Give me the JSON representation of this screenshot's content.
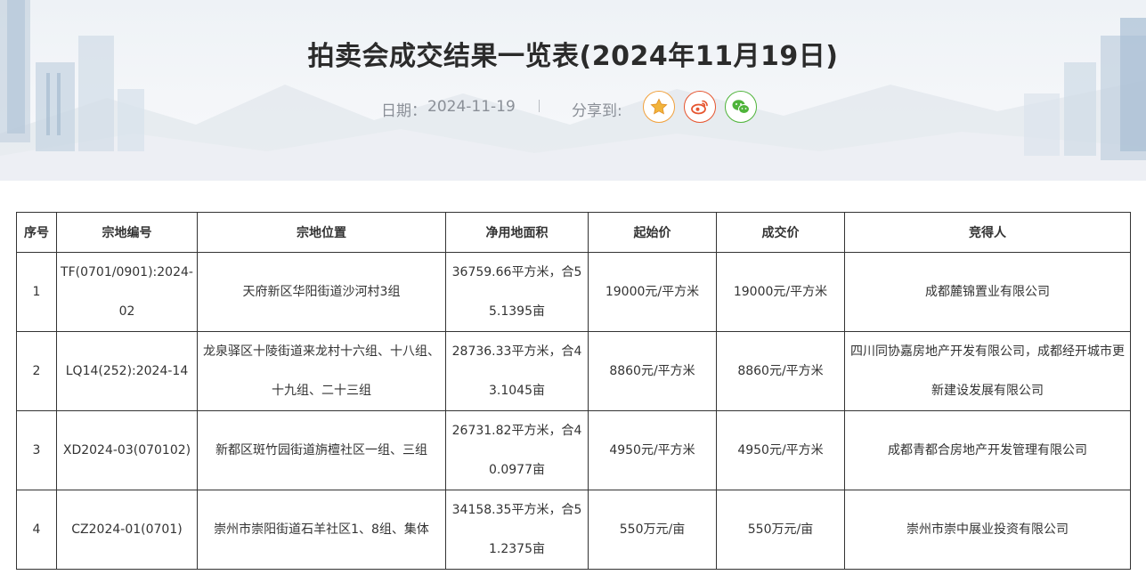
{
  "header": {
    "title": "拍卖会成交结果一览表(2024年11月19日)",
    "date_label": "日期：",
    "date": "2024-11-19",
    "separator": "|",
    "share_label": "分享到:"
  },
  "share_icons": [
    "star-icon",
    "weibo-icon",
    "wechat-icon"
  ],
  "colors": {
    "star": "#f1a13c",
    "weibo": "#e6552f",
    "wechat": "#4fb43a"
  },
  "table": {
    "headers": [
      "序号",
      "宗地编号",
      "宗地位置",
      "净用地面积",
      "起始价",
      "成交价",
      "竞得人"
    ],
    "rows": [
      [
        "1",
        "TF(0701/0901):2024-02",
        "天府新区华阳街道沙河村3组",
        "36759.66平方米，合55.1395亩",
        "19000元/平方米",
        "19000元/平方米",
        "成都麓锦置业有限公司"
      ],
      [
        "2",
        "LQ14(252):2024-14",
        "龙泉驿区十陵街道来龙村十六组、十八组、十九组、二十三组",
        "28736.33平方米，合43.1045亩",
        "8860元/平方米",
        "8860元/平方米",
        "四川同协嘉房地产开发有限公司，成都经开城市更新建设发展有限公司"
      ],
      [
        "3",
        "XD2024-03(070102)",
        "新都区斑竹园街道旃檀社区一组、三组",
        "26731.82平方米，合40.0977亩",
        "4950元/平方米",
        "4950元/平方米",
        "成都青都合房地产开发管理有限公司"
      ],
      [
        "4",
        "CZ2024-01(0701)",
        "崇州市崇阳街道石羊社区1、8组、集体",
        "34158.35平方米，合51.2375亩",
        "550万元/亩",
        "550万元/亩",
        "崇州市崇中展业投资有限公司"
      ]
    ]
  }
}
